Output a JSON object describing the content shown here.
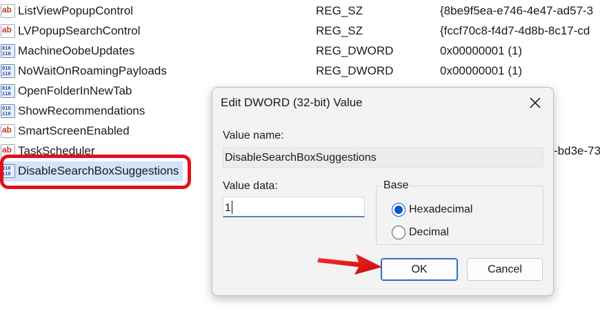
{
  "registry": {
    "rows": [
      {
        "name": "ListViewPopupControl",
        "type": "REG_SZ",
        "data": "{8be9f5ea-e746-4e47-ad57-3",
        "icon": "string-value-icon"
      },
      {
        "name": "LVPopupSearchControl",
        "type": "REG_SZ",
        "data": "{fccf70c8-f4d7-4d8b-8c17-cd",
        "icon": "string-value-icon"
      },
      {
        "name": "MachineOobeUpdates",
        "type": "REG_DWORD",
        "data": "0x00000001 (1)",
        "icon": "binary-value-icon"
      },
      {
        "name": "NoWaitOnRoamingPayloads",
        "type": "REG_DWORD",
        "data": "0x00000001 (1)",
        "icon": "binary-value-icon"
      },
      {
        "name": "OpenFolderInNewTab",
        "type": "",
        "data": "",
        "icon": "binary-value-icon"
      },
      {
        "name": "ShowRecommendations",
        "type": "",
        "data": "",
        "icon": "binary-value-icon"
      },
      {
        "name": "SmartScreenEnabled",
        "type": "",
        "data": "",
        "icon": "string-value-icon"
      },
      {
        "name": "TaskScheduler",
        "type": "",
        "data": "-bd3e-73",
        "icon": "string-value-icon"
      },
      {
        "name": "DisableSearchBoxSuggestions",
        "type": "",
        "data": "",
        "icon": "binary-value-icon"
      }
    ],
    "highlight_color": "#e3101c",
    "selected_color": "#d0e4fb"
  },
  "dialog": {
    "title": "Edit DWORD (32-bit) Value",
    "value_name_label": "Value name:",
    "value_name": "DisableSearchBoxSuggestions",
    "value_data_label": "Value data:",
    "value_data": "1",
    "base_label": "Base",
    "base_options": [
      {
        "label": "Hexadecimal",
        "checked": true
      },
      {
        "label": "Decimal",
        "checked": false
      }
    ],
    "ok_label": "OK",
    "cancel_label": "Cancel",
    "accent_color": "#0b57c4"
  },
  "annotation": {
    "arrow_color": "#e3101c"
  }
}
